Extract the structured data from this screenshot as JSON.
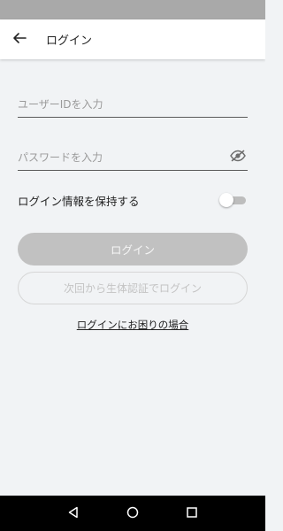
{
  "header": {
    "title": "ログイン",
    "back_icon": "arrow-left-icon"
  },
  "form": {
    "userid_placeholder": "ユーザーIDを入力",
    "userid_value": "",
    "password_placeholder": "パスワードを入力",
    "password_value": "",
    "password_visibility_icon": "eye-off-icon",
    "remember_label": "ログイン情報を保持する",
    "remember_enabled": false
  },
  "buttons": {
    "login_label": "ログイン",
    "biometric_label": "次回から生体認証でログイン",
    "help_link": "ログインにお困りの場合"
  },
  "nav": {
    "back_icon": "triangle-back-icon",
    "home_icon": "circle-home-icon",
    "recents_icon": "square-recents-icon"
  },
  "colors": {
    "status_bar": "#a9a9a9",
    "background": "#f1f3f5",
    "login_button": "#c1c1c1",
    "nav_bar": "#000000"
  }
}
